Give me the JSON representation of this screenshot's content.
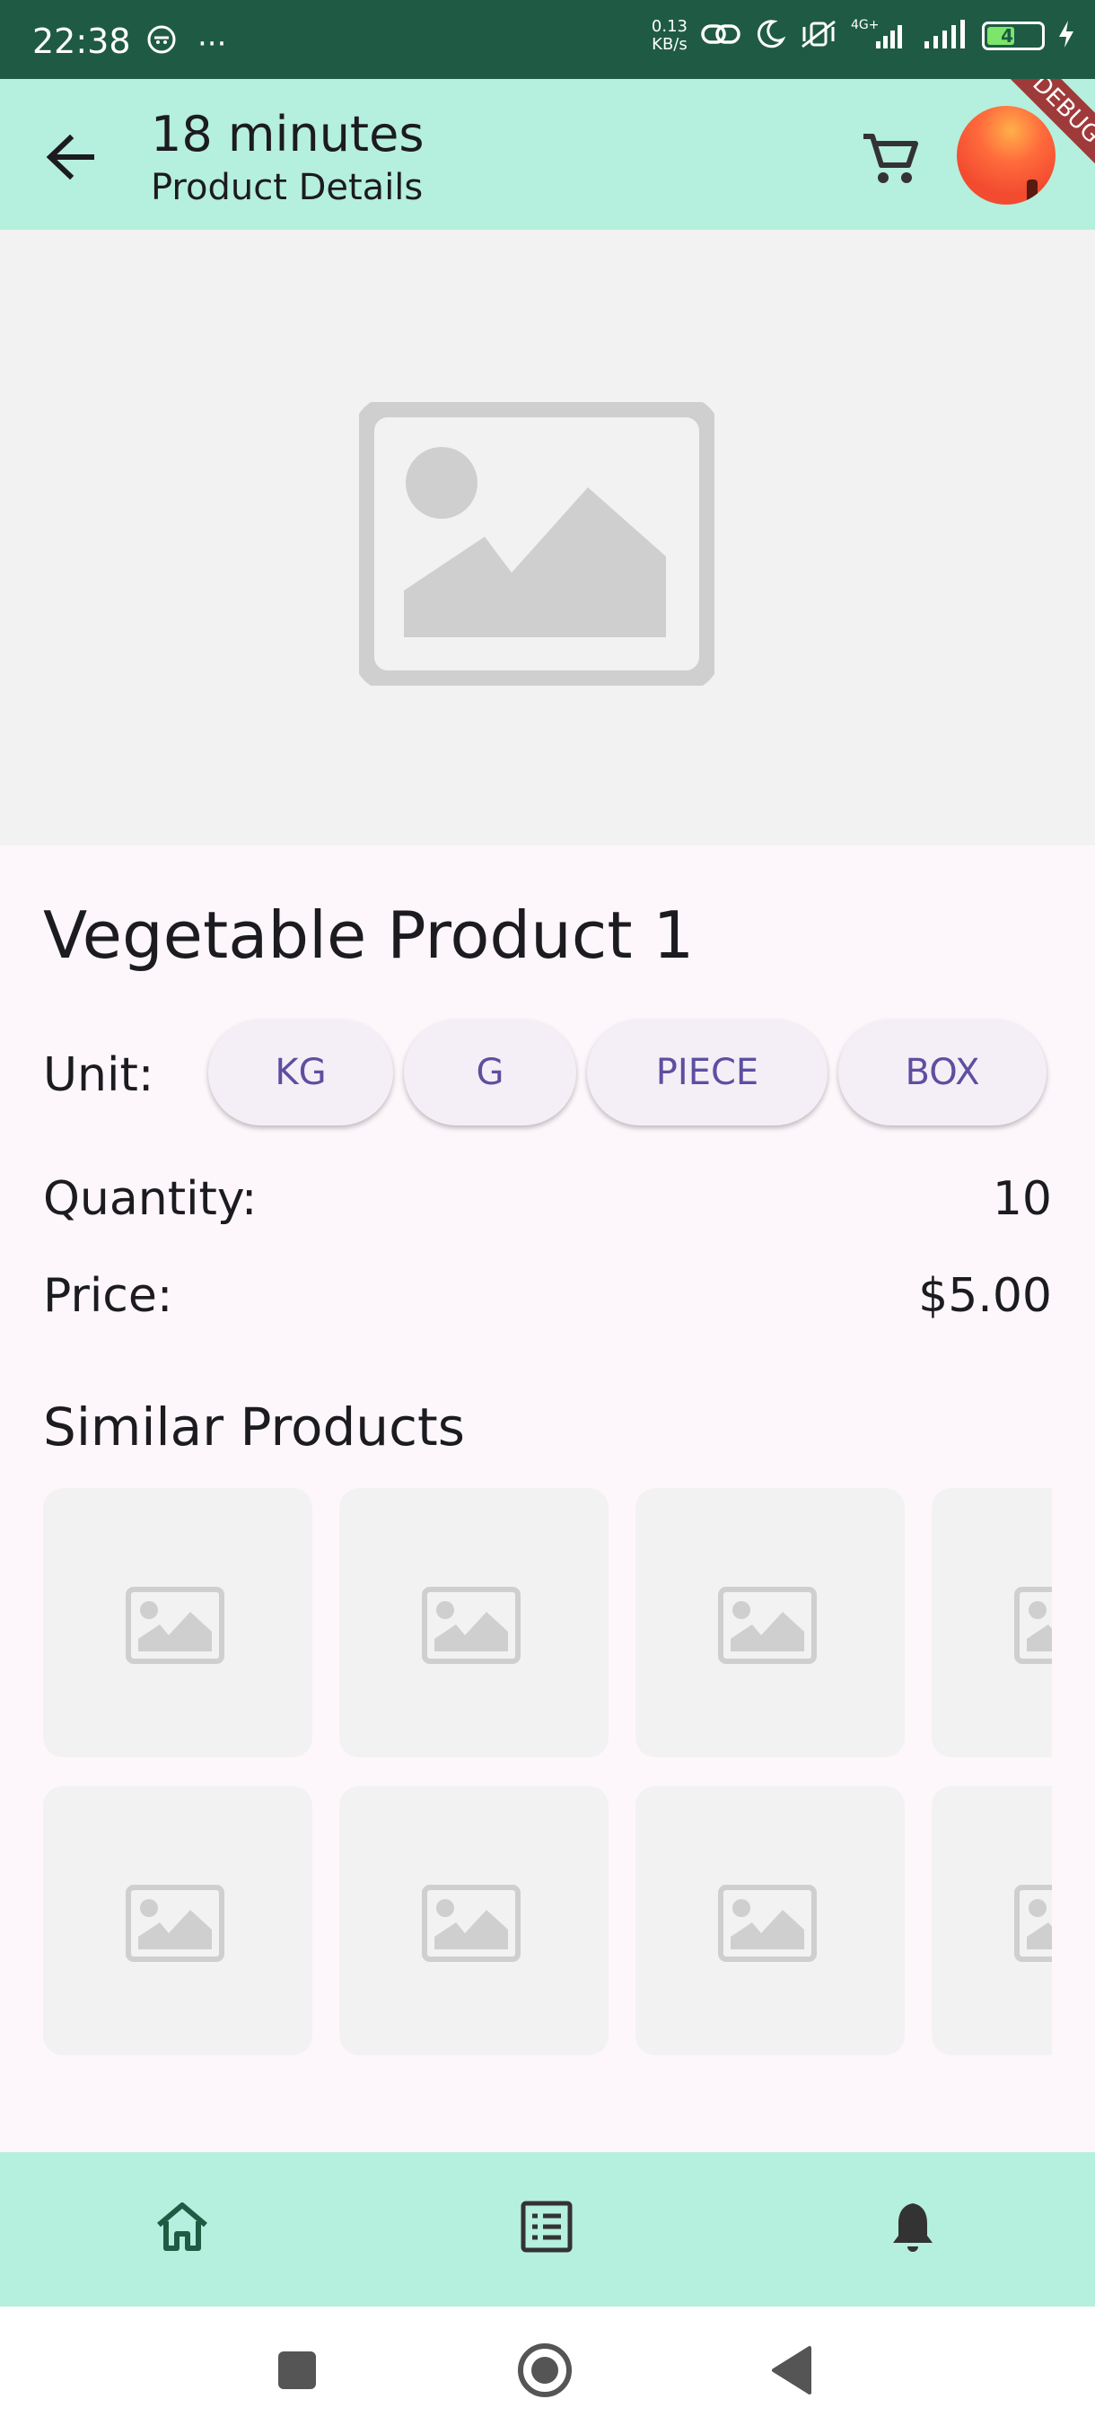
{
  "status_bar": {
    "time": "22:38",
    "extra_icons": "···",
    "net_speed_value": "0.13",
    "net_speed_unit": "KB/s",
    "network_type": "4G+",
    "battery": "47"
  },
  "app_bar": {
    "title": "18 minutes",
    "subtitle": "Product Details",
    "debug_banner": "DEBUG"
  },
  "product": {
    "name": "Vegetable Product 1",
    "unit_label": "Unit:",
    "units": [
      "KG",
      "G",
      "PIECE",
      "BOX"
    ],
    "quantity_label": "Quantity:",
    "quantity_value": "10",
    "price_label": "Price:",
    "price_value": "$5.00"
  },
  "similar": {
    "title": "Similar Products"
  },
  "bottom_nav": {
    "items": [
      "home-icon",
      "list-icon",
      "bell-icon"
    ]
  },
  "colors": {
    "status_bar": "#1f5b44",
    "app_bar": "#b5efdd",
    "chip_text": "#5d4fa0",
    "nav_icon": "#1f5b44"
  }
}
